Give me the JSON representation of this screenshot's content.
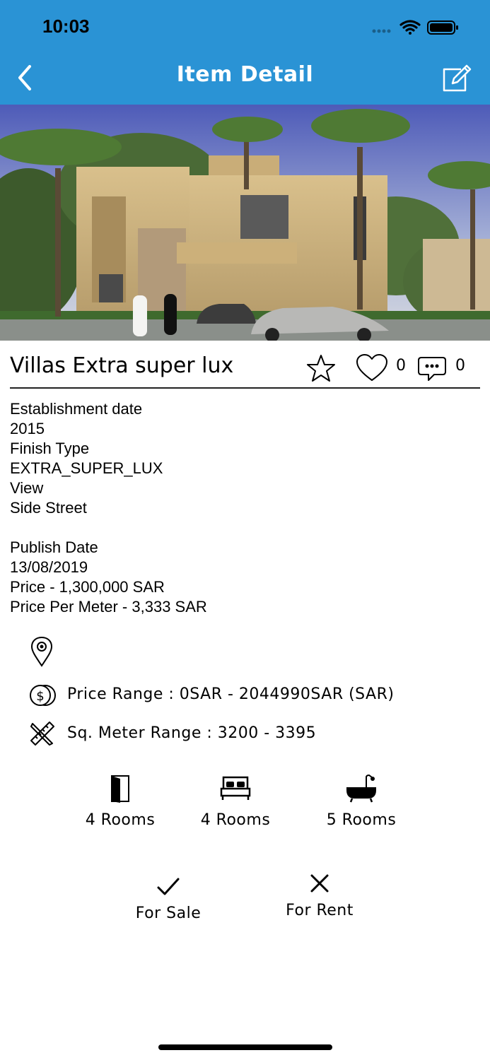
{
  "status_bar": {
    "time": "10:03"
  },
  "header": {
    "title": "Item Detail",
    "accent_color": "#2a93d5"
  },
  "item": {
    "title": "Villas Extra super lux",
    "likes": "0",
    "comments": "0"
  },
  "details": {
    "establishment_label": "Establishment date",
    "establishment_value": "2015",
    "finish_label": "Finish Type",
    "finish_value": "EXTRA_SUPER_LUX",
    "view_label": "View",
    "view_value": "Side Street",
    "publish_label": "Publish Date",
    "publish_value": "13/08/2019",
    "price": "Price - 1,300,000 SAR",
    "price_per_meter": "Price Per Meter - 3,333 SAR"
  },
  "ranges": {
    "price_range": "Price Range : 0SAR - 2044990SAR (SAR)",
    "sqm_range": "Sq. Meter Range : 3200 - 3395"
  },
  "rooms": [
    {
      "icon": "door-icon",
      "label": "4 Rooms"
    },
    {
      "icon": "bed-icon",
      "label": "4 Rooms"
    },
    {
      "icon": "bathtub-icon",
      "label": "5 Rooms"
    }
  ],
  "flags": [
    {
      "icon": "check-icon",
      "label": "For Sale"
    },
    {
      "icon": "cross-icon",
      "label": "For Rent"
    }
  ]
}
